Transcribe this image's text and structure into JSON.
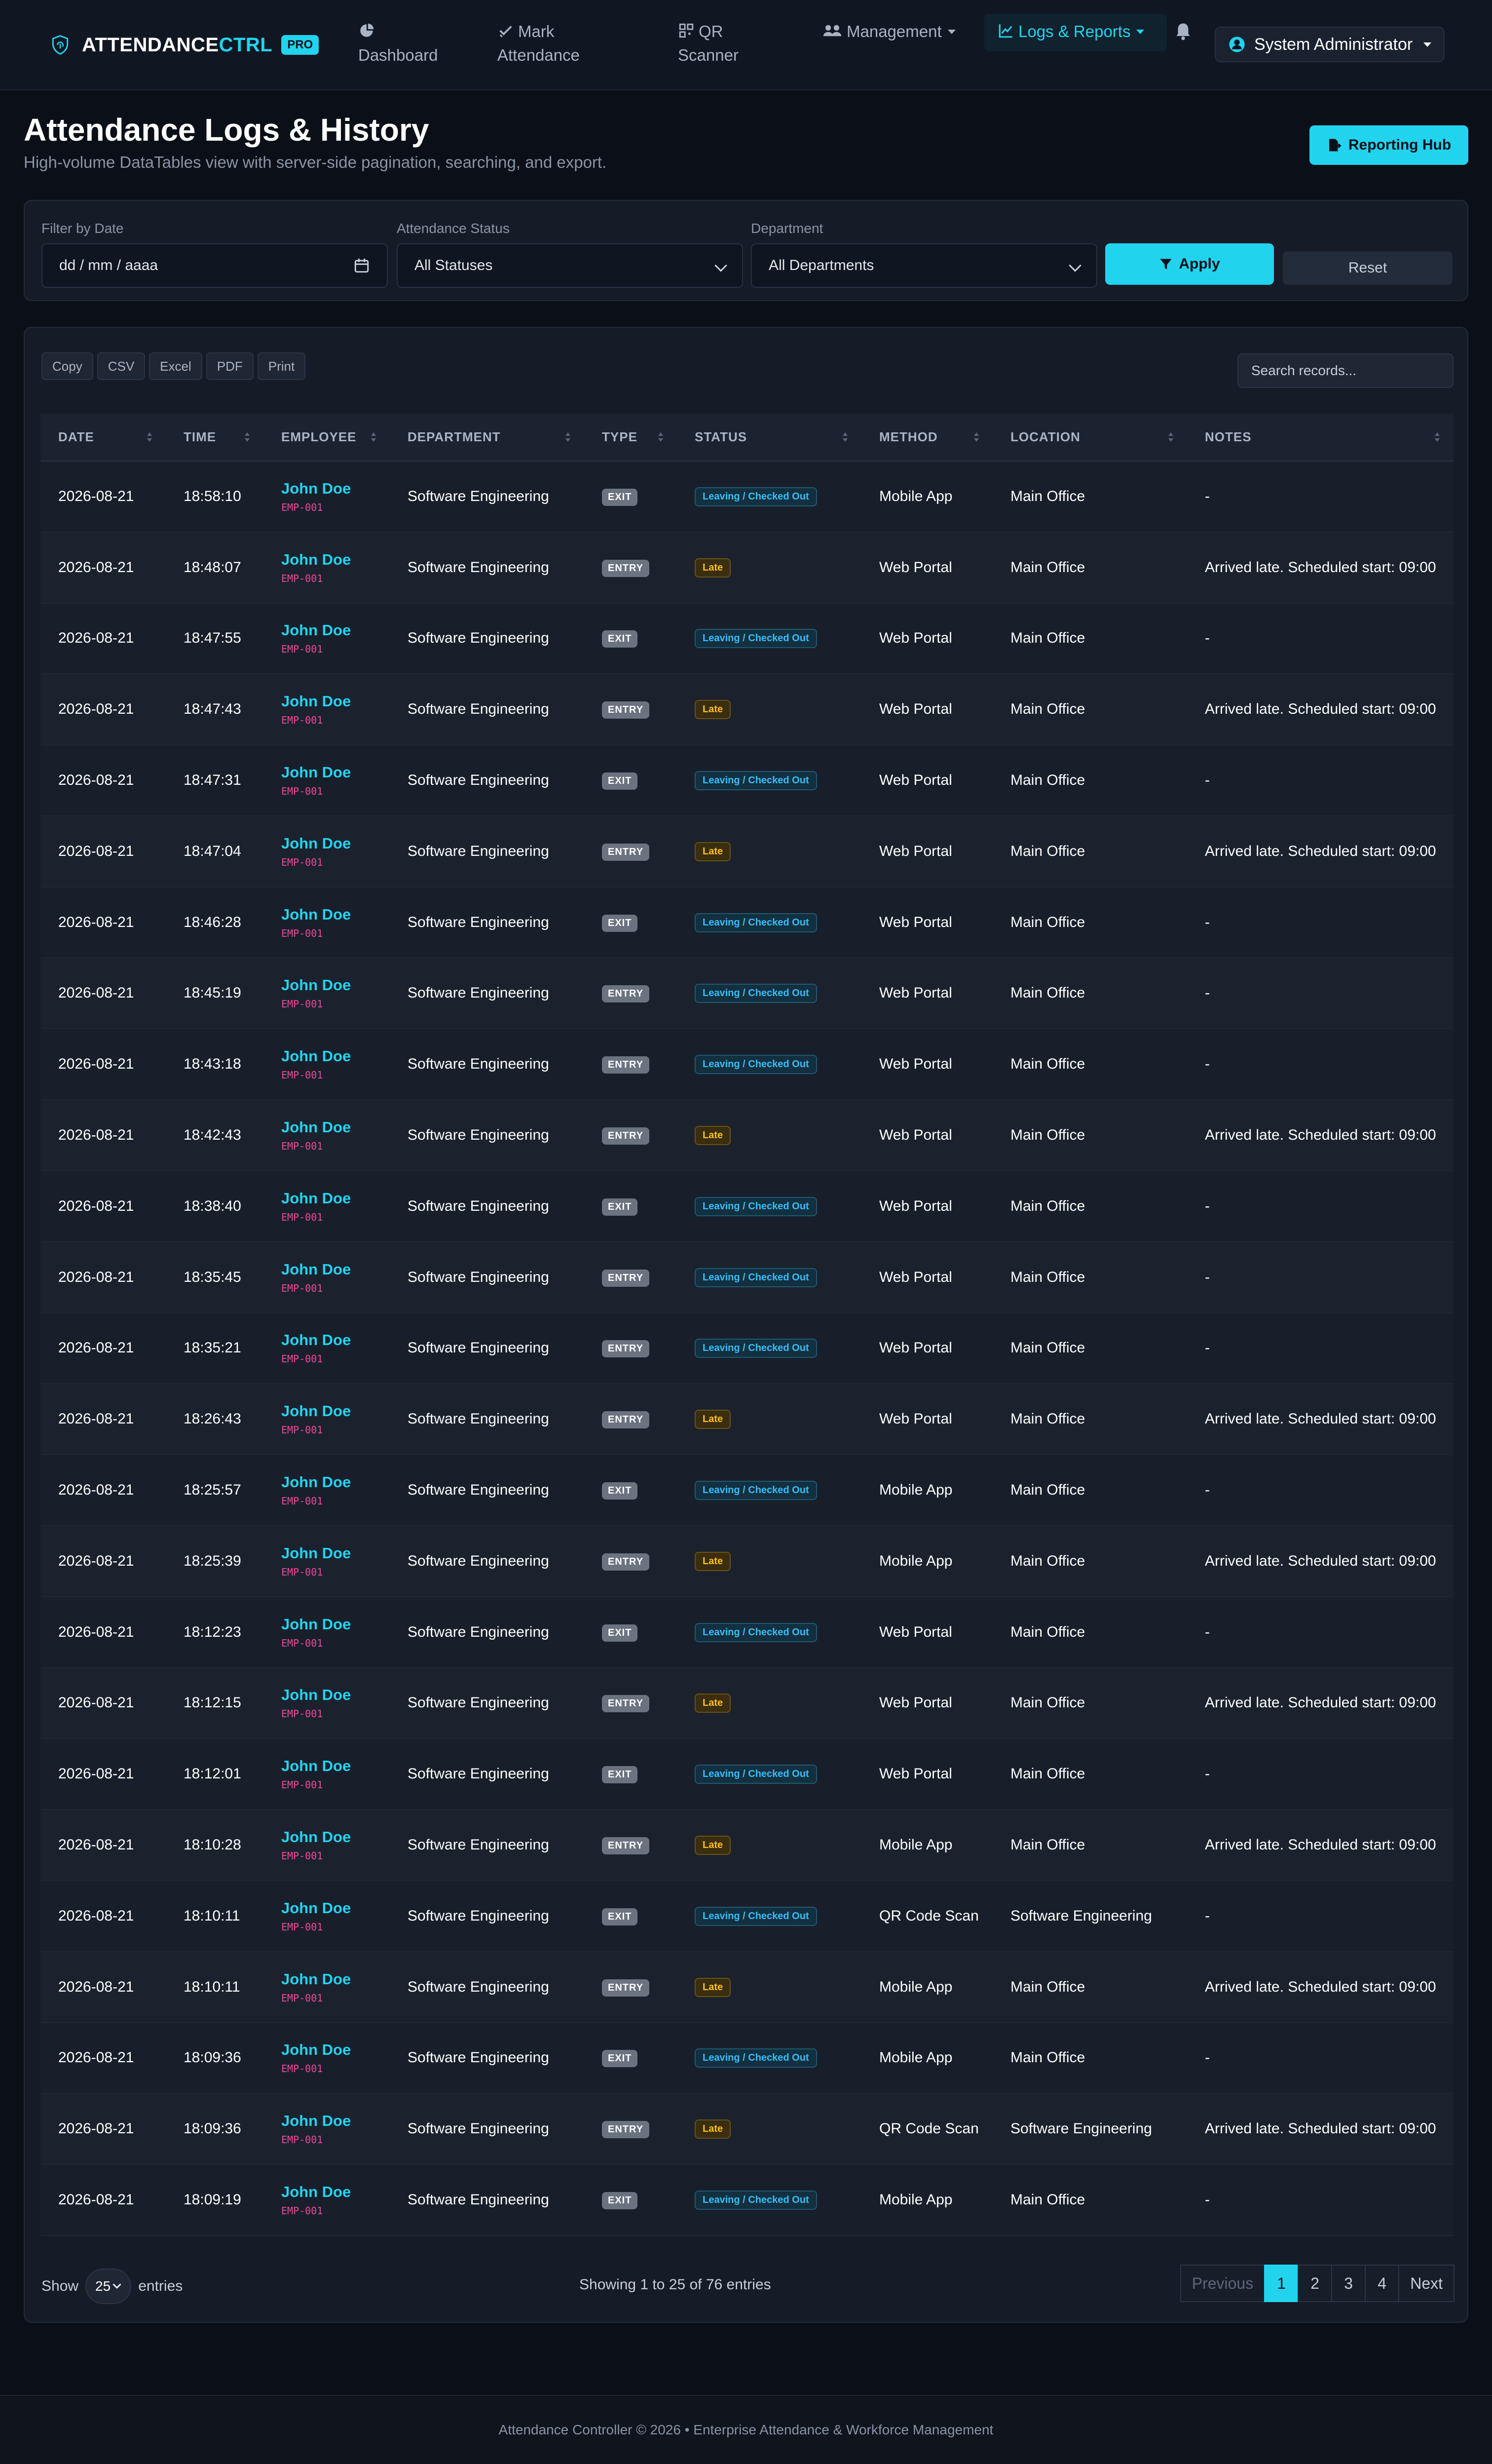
{
  "navbar": {
    "brand_part1": "ATTENDANCE",
    "brand_part2": "CTRL",
    "badge": "PRO",
    "items": [
      {
        "label_line1": "Dashboard",
        "label_line2": "",
        "icon": "pie-chart-icon"
      },
      {
        "label_line1": "Mark",
        "label_line2": "Attendance",
        "icon": "check-icon"
      },
      {
        "label_line1": "QR",
        "label_line2": "Scanner",
        "icon": "qr-icon"
      },
      {
        "label_line1": "Management",
        "label_line2": "",
        "icon": "users-icon"
      },
      {
        "label_line1": "Logs & Reports",
        "label_line2": "",
        "icon": "chart-line-icon"
      }
    ],
    "bell_icon": "bell-icon",
    "user": "System Administrator"
  },
  "header": {
    "title": "Attendance Logs & History",
    "subtitle": "High-volume DataTables view with server-side pagination, searching, and export.",
    "hub_button": "Reporting Hub"
  },
  "filters": {
    "date_label": "Filter by Date",
    "date_placeholder": "dd / mm / aaaa",
    "status_label": "Attendance Status",
    "status_value": "All Statuses",
    "dept_label": "Department",
    "dept_value": "All Departments",
    "apply": "Apply",
    "reset": "Reset"
  },
  "table": {
    "export_buttons": [
      "Copy",
      "CSV",
      "Excel",
      "PDF",
      "Print"
    ],
    "search_placeholder": "Search records...",
    "columns": [
      "DATE",
      "TIME",
      "EMPLOYEE",
      "DEPARTMENT",
      "TYPE",
      "STATUS",
      "METHOD",
      "LOCATION",
      "NOTES"
    ],
    "rows": [
      [
        "2026-08-21",
        "18:58:10",
        "John Doe",
        "EMP-001",
        "Software Engineering",
        "EXIT",
        "Leaving / Checked Out",
        "Mobile App",
        "Main Office",
        "-"
      ],
      [
        "2026-08-21",
        "18:48:07",
        "John Doe",
        "EMP-001",
        "Software Engineering",
        "ENTRY",
        "Late",
        "Web Portal",
        "Main Office",
        "Arrived late. Scheduled start: 09:00"
      ],
      [
        "2026-08-21",
        "18:47:55",
        "John Doe",
        "EMP-001",
        "Software Engineering",
        "EXIT",
        "Leaving / Checked Out",
        "Web Portal",
        "Main Office",
        "-"
      ],
      [
        "2026-08-21",
        "18:47:43",
        "John Doe",
        "EMP-001",
        "Software Engineering",
        "ENTRY",
        "Late",
        "Web Portal",
        "Main Office",
        "Arrived late. Scheduled start: 09:00"
      ],
      [
        "2026-08-21",
        "18:47:31",
        "John Doe",
        "EMP-001",
        "Software Engineering",
        "EXIT",
        "Leaving / Checked Out",
        "Web Portal",
        "Main Office",
        "-"
      ],
      [
        "2026-08-21",
        "18:47:04",
        "John Doe",
        "EMP-001",
        "Software Engineering",
        "ENTRY",
        "Late",
        "Web Portal",
        "Main Office",
        "Arrived late. Scheduled start: 09:00"
      ],
      [
        "2026-08-21",
        "18:46:28",
        "John Doe",
        "EMP-001",
        "Software Engineering",
        "EXIT",
        "Leaving / Checked Out",
        "Web Portal",
        "Main Office",
        "-"
      ],
      [
        "2026-08-21",
        "18:45:19",
        "John Doe",
        "EMP-001",
        "Software Engineering",
        "ENTRY",
        "Leaving / Checked Out",
        "Web Portal",
        "Main Office",
        "-"
      ],
      [
        "2026-08-21",
        "18:43:18",
        "John Doe",
        "EMP-001",
        "Software Engineering",
        "ENTRY",
        "Leaving / Checked Out",
        "Web Portal",
        "Main Office",
        "-"
      ],
      [
        "2026-08-21",
        "18:42:43",
        "John Doe",
        "EMP-001",
        "Software Engineering",
        "ENTRY",
        "Late",
        "Web Portal",
        "Main Office",
        "Arrived late. Scheduled start: 09:00"
      ],
      [
        "2026-08-21",
        "18:38:40",
        "John Doe",
        "EMP-001",
        "Software Engineering",
        "EXIT",
        "Leaving / Checked Out",
        "Web Portal",
        "Main Office",
        "-"
      ],
      [
        "2026-08-21",
        "18:35:45",
        "John Doe",
        "EMP-001",
        "Software Engineering",
        "ENTRY",
        "Leaving / Checked Out",
        "Web Portal",
        "Main Office",
        "-"
      ],
      [
        "2026-08-21",
        "18:35:21",
        "John Doe",
        "EMP-001",
        "Software Engineering",
        "ENTRY",
        "Leaving / Checked Out",
        "Web Portal",
        "Main Office",
        "-"
      ],
      [
        "2026-08-21",
        "18:26:43",
        "John Doe",
        "EMP-001",
        "Software Engineering",
        "ENTRY",
        "Late",
        "Web Portal",
        "Main Office",
        "Arrived late. Scheduled start: 09:00"
      ],
      [
        "2026-08-21",
        "18:25:57",
        "John Doe",
        "EMP-001",
        "Software Engineering",
        "EXIT",
        "Leaving / Checked Out",
        "Mobile App",
        "Main Office",
        "-"
      ],
      [
        "2026-08-21",
        "18:25:39",
        "John Doe",
        "EMP-001",
        "Software Engineering",
        "ENTRY",
        "Late",
        "Mobile App",
        "Main Office",
        "Arrived late. Scheduled start: 09:00"
      ],
      [
        "2026-08-21",
        "18:12:23",
        "John Doe",
        "EMP-001",
        "Software Engineering",
        "EXIT",
        "Leaving / Checked Out",
        "Web Portal",
        "Main Office",
        "-"
      ],
      [
        "2026-08-21",
        "18:12:15",
        "John Doe",
        "EMP-001",
        "Software Engineering",
        "ENTRY",
        "Late",
        "Web Portal",
        "Main Office",
        "Arrived late. Scheduled start: 09:00"
      ],
      [
        "2026-08-21",
        "18:12:01",
        "John Doe",
        "EMP-001",
        "Software Engineering",
        "EXIT",
        "Leaving / Checked Out",
        "Web Portal",
        "Main Office",
        "-"
      ],
      [
        "2026-08-21",
        "18:10:28",
        "John Doe",
        "EMP-001",
        "Software Engineering",
        "ENTRY",
        "Late",
        "Mobile App",
        "Main Office",
        "Arrived late. Scheduled start: 09:00"
      ],
      [
        "2026-08-21",
        "18:10:11",
        "John Doe",
        "EMP-001",
        "Software Engineering",
        "EXIT",
        "Leaving / Checked Out",
        "QR Code Scan",
        "Software Engineering",
        "-"
      ],
      [
        "2026-08-21",
        "18:10:11",
        "John Doe",
        "EMP-001",
        "Software Engineering",
        "ENTRY",
        "Late",
        "Mobile App",
        "Main Office",
        "Arrived late. Scheduled start: 09:00"
      ],
      [
        "2026-08-21",
        "18:09:36",
        "John Doe",
        "EMP-001",
        "Software Engineering",
        "EXIT",
        "Leaving / Checked Out",
        "Mobile App",
        "Main Office",
        "-"
      ],
      [
        "2026-08-21",
        "18:09:36",
        "John Doe",
        "EMP-001",
        "Software Engineering",
        "ENTRY",
        "Late",
        "QR Code Scan",
        "Software Engineering",
        "Arrived late. Scheduled start: 09:00"
      ],
      [
        "2026-08-21",
        "18:09:19",
        "John Doe",
        "EMP-001",
        "Software Engineering",
        "EXIT",
        "Leaving / Checked Out",
        "Mobile App",
        "Main Office",
        "-"
      ]
    ],
    "show_label": "Show",
    "page_length": "25",
    "entries_label": "entries",
    "info": "Showing 1 to 25 of 76 entries",
    "pagination": [
      "Previous",
      "1",
      "2",
      "3",
      "4",
      "Next"
    ],
    "active_page": "1"
  },
  "footer": {
    "text": "Attendance Controller © 2026 • Enterprise Attendance & Workforce Management"
  },
  "colors": {
    "accent": "#22d3ee",
    "background": "#0b0f17",
    "employee_id": "#ec4899",
    "late": "#fbbf24",
    "checked_out": "#38bdf8"
  }
}
